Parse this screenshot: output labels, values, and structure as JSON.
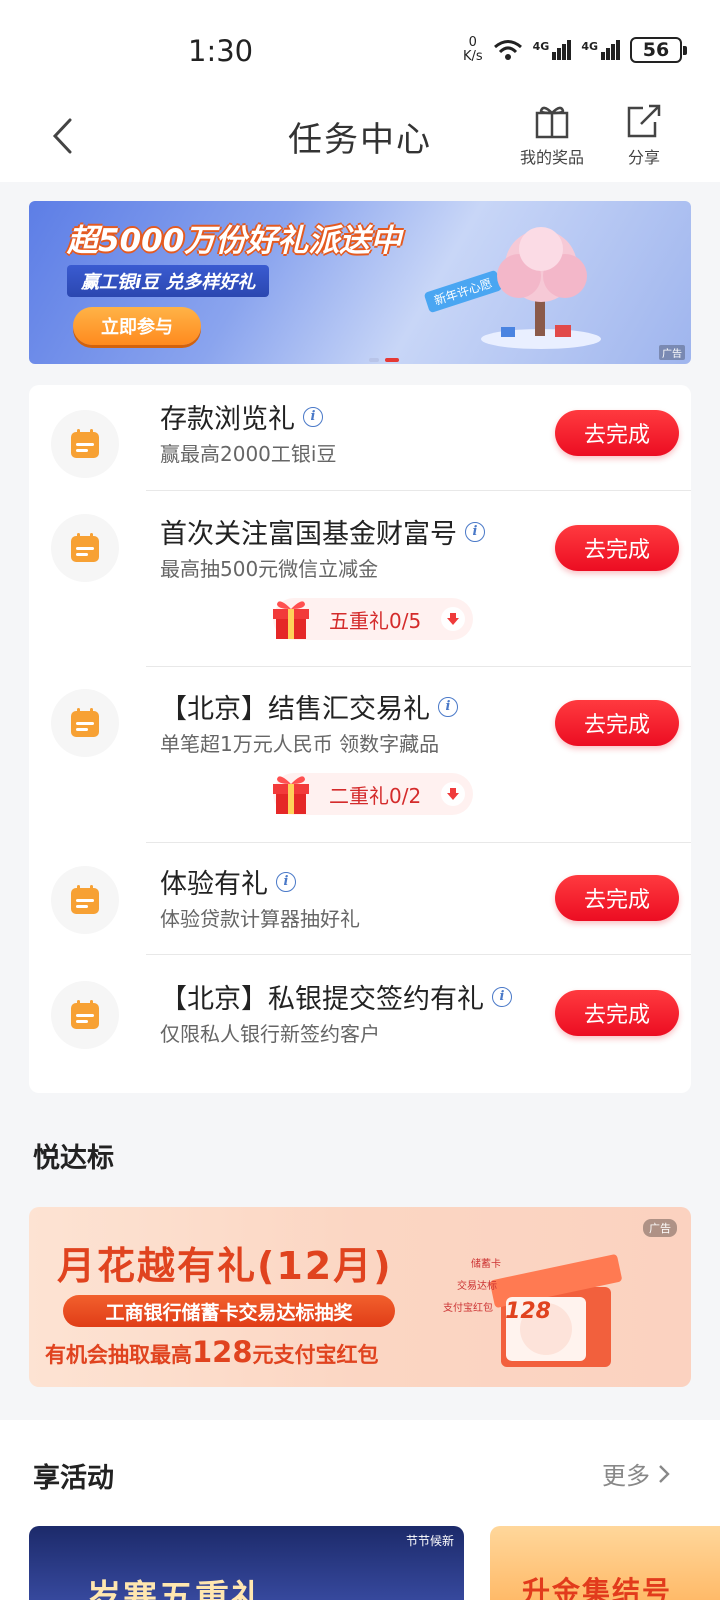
{
  "status_bar": {
    "time": "1:30",
    "speed_value": "0",
    "speed_unit": "K/s",
    "net1": "4G",
    "net2": "4G",
    "battery": "56"
  },
  "header": {
    "title": "任务中心",
    "prizes_label": "我的奖品",
    "share_label": "分享"
  },
  "banner": {
    "headline": "超5000万份好礼派送中",
    "sub": "赢工银i豆 兑多样好礼",
    "cta": "立即参与",
    "tag": "新年许心愿",
    "ad": "广告"
  },
  "tasks": [
    {
      "title": "存款浏览礼",
      "desc": "赢最高2000工银i豆",
      "button": "去完成"
    },
    {
      "title": "首次关注富国基金财富号",
      "desc": "最高抽500元微信立减金",
      "button": "去完成",
      "gift": "五重礼0/5"
    },
    {
      "title": "【北京】结售汇交易礼",
      "desc": "单笔超1万元人民币 领数字藏品",
      "button": "去完成",
      "gift": "二重礼0/2"
    },
    {
      "title": "体验有礼",
      "desc": "体验贷款计算器抽好礼",
      "button": "去完成"
    },
    {
      "title": "【北京】私银提交签约有礼",
      "desc": "仅限私人银行新签约客户",
      "button": "去完成"
    }
  ],
  "section1": {
    "title": "悦达标"
  },
  "promo2": {
    "title": "月花越有礼(12月)",
    "sub": "工商银行储蓄卡交易达标抽奖",
    "desc_pre": "有机会抽取最高",
    "desc_amount": "128",
    "desc_post": "元支付宝红包",
    "ad": "广告",
    "label1": "储蓄卡",
    "label2": "交易达标",
    "label3": "支付宝红包",
    "coupon": "128"
  },
  "section2": {
    "title": "享活动",
    "more": "更多"
  },
  "activities": [
    {
      "title": "岁寒五重礼",
      "tag": "节节候新"
    },
    {
      "title": "升金集结号"
    }
  ],
  "colors": {
    "primary_red": "#ec0d22",
    "accent_orange": "#f7a134",
    "link_blue": "#4a79c8"
  }
}
